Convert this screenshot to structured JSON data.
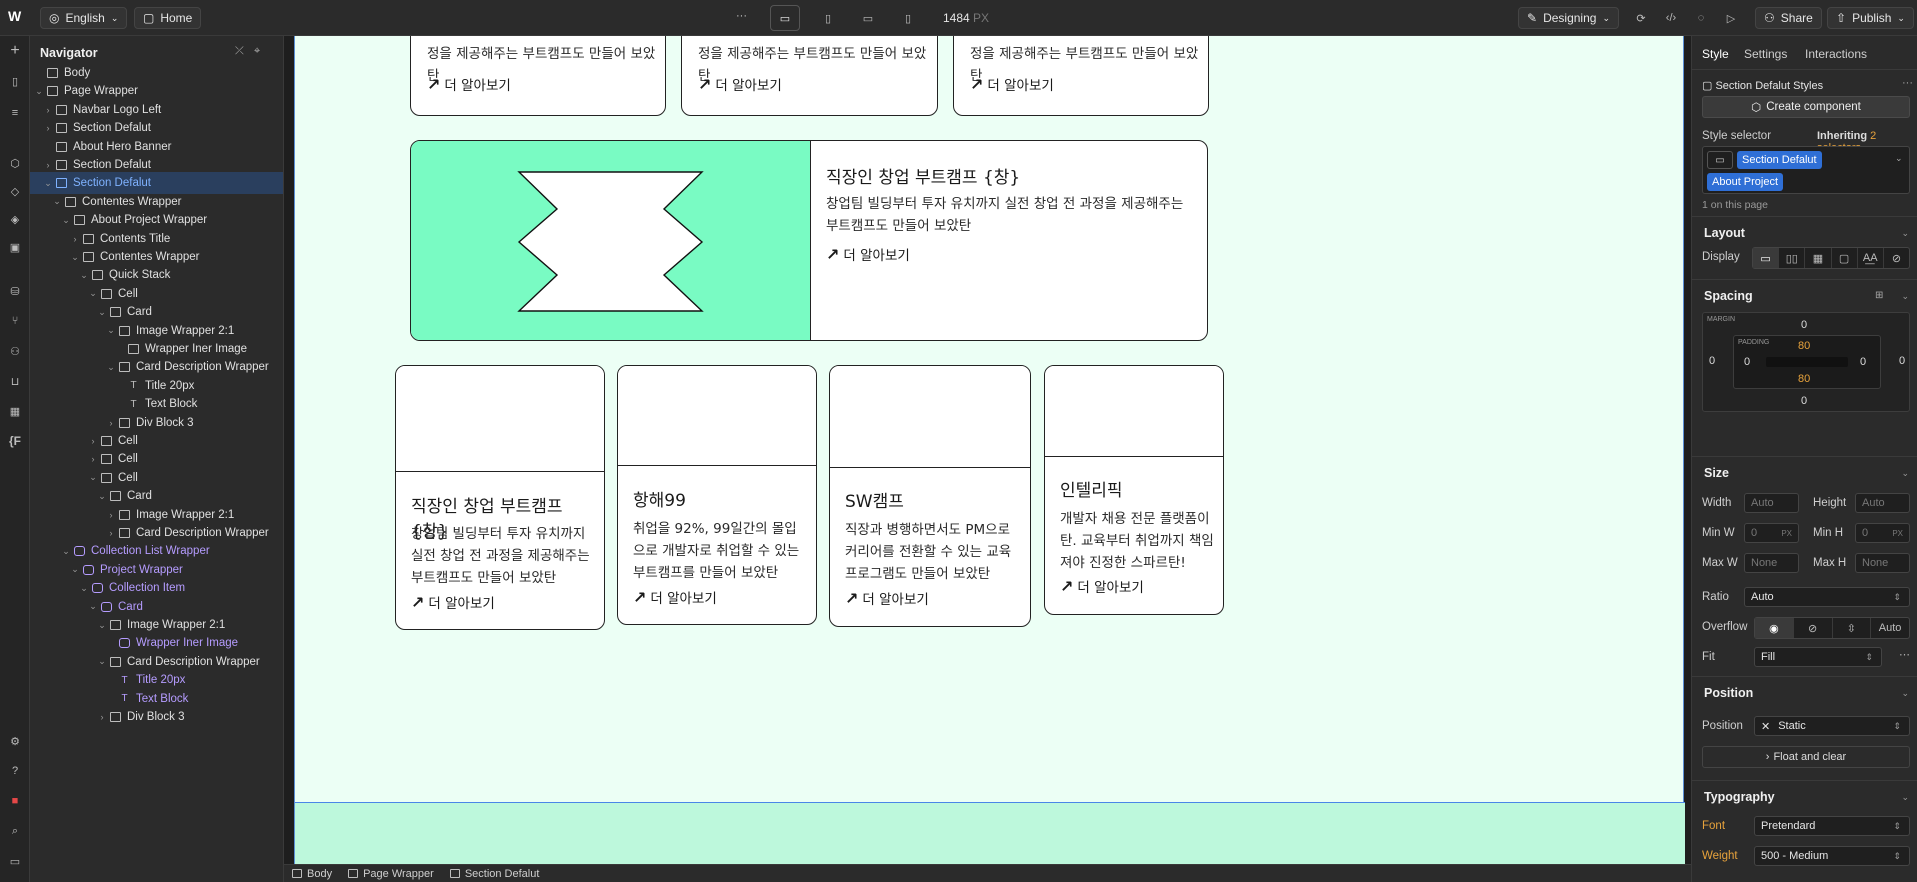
{
  "topbar": {
    "locale": "English",
    "page": "Home",
    "more": "···",
    "width_value": "1484",
    "width_unit": "PX",
    "mode": "Designing",
    "share": "Share",
    "publish": "Publish"
  },
  "navigator": {
    "title": "Navigator",
    "rows": [
      {
        "label": "Body"
      },
      {
        "label": "Page Wrapper"
      },
      {
        "label": "Navbar Logo Left"
      },
      {
        "label": "Section Defalut"
      },
      {
        "label": "About Hero Banner"
      },
      {
        "label": "Section Defalut"
      },
      {
        "label": "Section Defalut"
      },
      {
        "label": "Contentes Wrapper"
      },
      {
        "label": "About Project Wrapper"
      },
      {
        "label": "Contents Title"
      },
      {
        "label": "Contentes Wrapper"
      },
      {
        "label": "Quick Stack"
      },
      {
        "label": "Cell"
      },
      {
        "label": "Card"
      },
      {
        "label": "Image Wrapper 2:1"
      },
      {
        "label": "Wrapper Iner Image"
      },
      {
        "label": "Card Description Wrapper"
      },
      {
        "label": "Title 20px"
      },
      {
        "label": "Text Block"
      },
      {
        "label": "Div Block 3"
      },
      {
        "label": "Cell"
      },
      {
        "label": "Cell"
      },
      {
        "label": "Cell"
      },
      {
        "label": "Card"
      },
      {
        "label": "Image Wrapper 2:1"
      },
      {
        "label": "Card Description Wrapper"
      },
      {
        "label": "Collection List Wrapper"
      },
      {
        "label": "Project Wrapper"
      },
      {
        "label": "Collection Item"
      },
      {
        "label": "Card"
      },
      {
        "label": "Image Wrapper 2:1"
      },
      {
        "label": "Wrapper Iner Image"
      },
      {
        "label": "Card Description Wrapper"
      },
      {
        "label": "Title 20px"
      },
      {
        "label": "Text Block"
      },
      {
        "label": "Div Block 3"
      }
    ]
  },
  "canvas": {
    "top_cards": [
      {
        "text": "정을 제공해주는 부트캠프도 만들어 보았탄",
        "link": "더 알아보기"
      },
      {
        "text": "정을 제공해주는 부트캠프도 만들어 보았탄",
        "link": "더 알아보기"
      },
      {
        "text": "정을 제공해주는 부트캠프도 만들어 보았탄",
        "link": "더 알아보기"
      }
    ],
    "feature": {
      "title": "직장인 창업 부트캠프 {창}",
      "text": "창업팀 빌딩부터 투자 유치까지 실전 창업 전 과정을 제공해주는 부트캠프도 만들어 보았탄",
      "link": "더 알아보기",
      "image_color": "#79fbc3"
    },
    "project_cards": [
      {
        "title": "직장인 창업 부트캠프 {창}",
        "text": "창업팀 빌딩부터 투자 유치까지 실전 창업 전 과정을 제공해주는 부트캠프도 만들어 보았탄",
        "link": "더 알아보기"
      },
      {
        "title": "항해99",
        "text": "취업을 92%, 99일간의 몰입으로 개발자로 취업할 수 있는 부트캠프를 만들어 보았탄",
        "link": "더 알아보기"
      },
      {
        "title": "SW캠프",
        "text": "직장과 병행하면서도 PM으로 커리어를 전환할 수 있는 교육 프로그램도 만들어 보았탄",
        "link": "더 알아보기"
      },
      {
        "title": "인텔리픽",
        "text": "개발자 채용 전문 플랫폼이탄. 교육부터 취업까지 책임져야 진정한 스파르탄!",
        "link": "더 알아보기"
      }
    ],
    "page_bg": "#ecfff5",
    "next_section_bg": "#bdf8dc"
  },
  "breadcrumb": [
    "Body",
    "Page Wrapper",
    "Section Defalut"
  ],
  "style_panel": {
    "tabs": [
      "Style",
      "Settings",
      "Interactions"
    ],
    "selected_styles_label": "Section Defalut Styles",
    "create_component": "Create component",
    "style_selector_label": "Style selector",
    "inheriting_prefix": "Inheriting",
    "inheriting_count": "2 selectors",
    "selector_chip": "Section Defalut",
    "selector_chip2": "About Project",
    "on_page": "1 on this page",
    "layout": {
      "title": "Layout",
      "display_label": "Display"
    },
    "spacing": {
      "title": "Spacing",
      "margin_label": "MARGIN",
      "padding_label": "PADDING",
      "margin": {
        "top": "0",
        "right": "0",
        "bottom": "0",
        "left": "0"
      },
      "padding": {
        "top": "80",
        "right": "0",
        "bottom": "80",
        "left": "0"
      }
    },
    "size": {
      "title": "Size",
      "width_label": "Width",
      "width_value": "Auto",
      "height_label": "Height",
      "height_value": "Auto",
      "minw_label": "Min W",
      "minw_value": "0",
      "minw_unit": "PX",
      "minh_label": "Min H",
      "minh_value": "0",
      "minh_unit": "PX",
      "maxw_label": "Max W",
      "maxw_value": "None",
      "maxh_label": "Max H",
      "maxh_value": "None",
      "ratio_label": "Ratio",
      "ratio_value": "Auto",
      "overflow_label": "Overflow",
      "overflow_auto": "Auto",
      "fit_label": "Fit",
      "fit_value": "Fill"
    },
    "position": {
      "title": "Position",
      "label": "Position",
      "value": "Static",
      "float_clear": "Float and clear"
    },
    "typography": {
      "title": "Typography",
      "font_label": "Font",
      "font_value": "Pretendard",
      "weight_label": "Weight",
      "weight_value": "500 - Medium"
    },
    "accent": "#4a86e8",
    "highlight": "#e8a33c"
  }
}
